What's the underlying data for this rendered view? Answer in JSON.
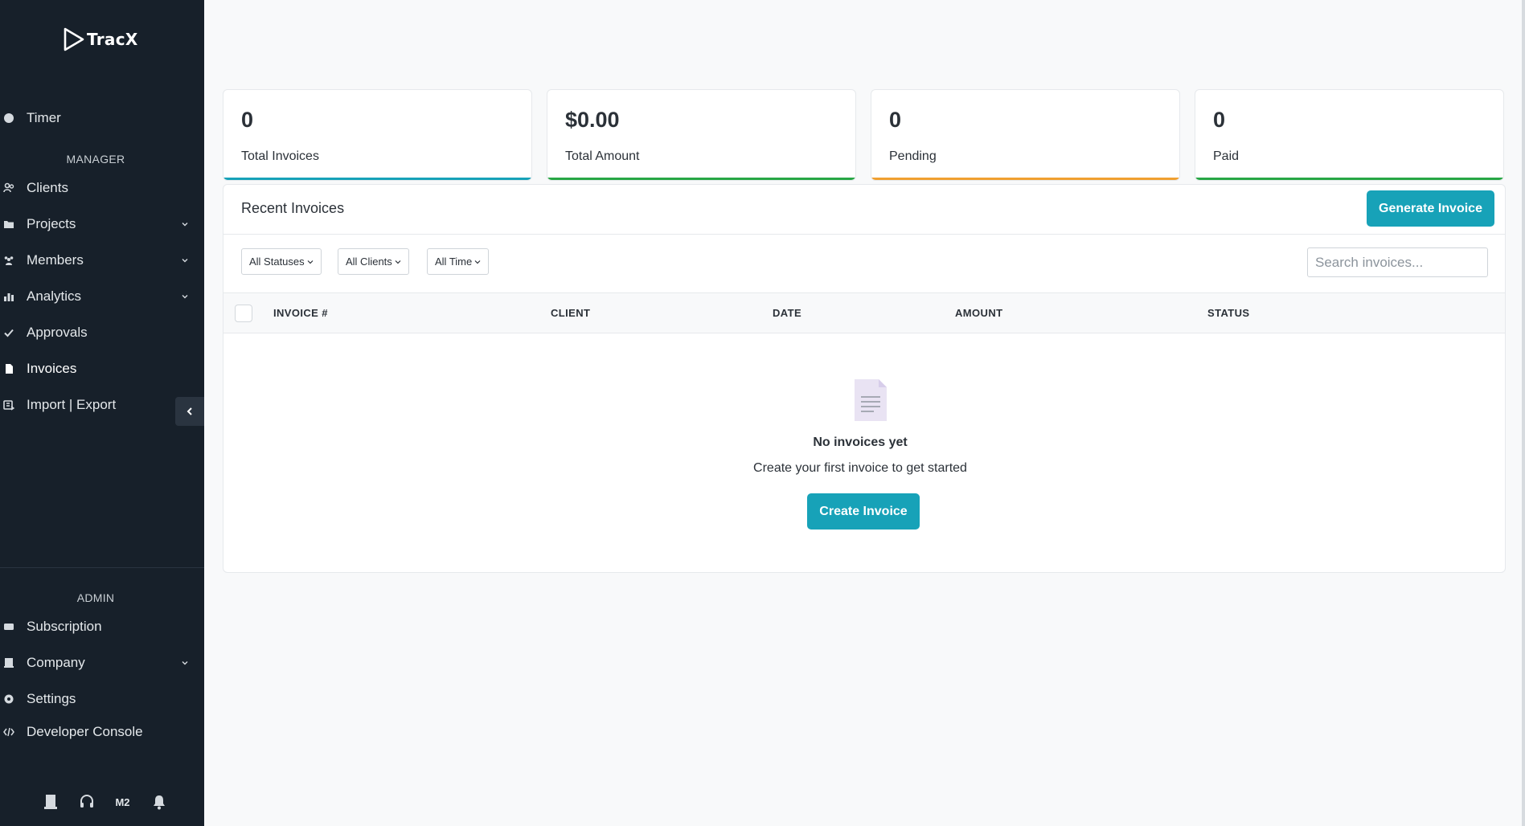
{
  "app": {
    "brand": "TracX"
  },
  "sidebar": {
    "timer": {
      "label": "Timer",
      "icon": "circle-icon"
    },
    "manager_section": "MANAGER",
    "manager_items": [
      {
        "label": "Clients",
        "icon": "users-icon",
        "has_submenu": false
      },
      {
        "label": "Projects",
        "icon": "folder-icon",
        "has_submenu": true
      },
      {
        "label": "Members",
        "icon": "team-icon",
        "has_submenu": true
      },
      {
        "label": "Analytics",
        "icon": "chart-icon",
        "has_submenu": true
      },
      {
        "label": "Approvals",
        "icon": "check-icon",
        "has_submenu": false
      },
      {
        "label": "Invoices",
        "icon": "file-icon",
        "has_submenu": false,
        "active": true
      },
      {
        "label": "Import | Export",
        "icon": "import-export-icon",
        "has_submenu": false
      }
    ],
    "admin_section": "ADMIN",
    "admin_items": [
      {
        "label": "Subscription",
        "icon": "card-icon",
        "has_submenu": false
      },
      {
        "label": "Company",
        "icon": "building-icon",
        "has_submenu": true
      },
      {
        "label": "Settings",
        "icon": "gear-icon",
        "has_submenu": false
      },
      {
        "label": "Developer Console",
        "icon": "code-icon",
        "has_submenu": false
      }
    ],
    "footer": {
      "user_initials": "M2"
    }
  },
  "stats": [
    {
      "value": "0",
      "label": "Total Invoices",
      "accent": "#17a2b8"
    },
    {
      "value": "$0.00",
      "label": "Total Amount",
      "accent": "#28a745"
    },
    {
      "value": "0",
      "label": "Pending",
      "accent": "#f0a030"
    },
    {
      "value": "0",
      "label": "Paid",
      "accent": "#28a745"
    }
  ],
  "invoices": {
    "title": "Recent Invoices",
    "generate_label": "Generate Invoice",
    "filters": {
      "status": "All Statuses",
      "client": "All Clients",
      "time": "All Time"
    },
    "search_placeholder": "Search invoices...",
    "columns": [
      "INVOICE #",
      "CLIENT",
      "DATE",
      "AMOUNT",
      "STATUS"
    ],
    "empty": {
      "title": "No invoices yet",
      "subtitle": "Create your first invoice to get started",
      "button": "Create Invoice"
    }
  },
  "colors": {
    "sidebar_bg": "#17202a",
    "primary": "#17a2b8"
  }
}
